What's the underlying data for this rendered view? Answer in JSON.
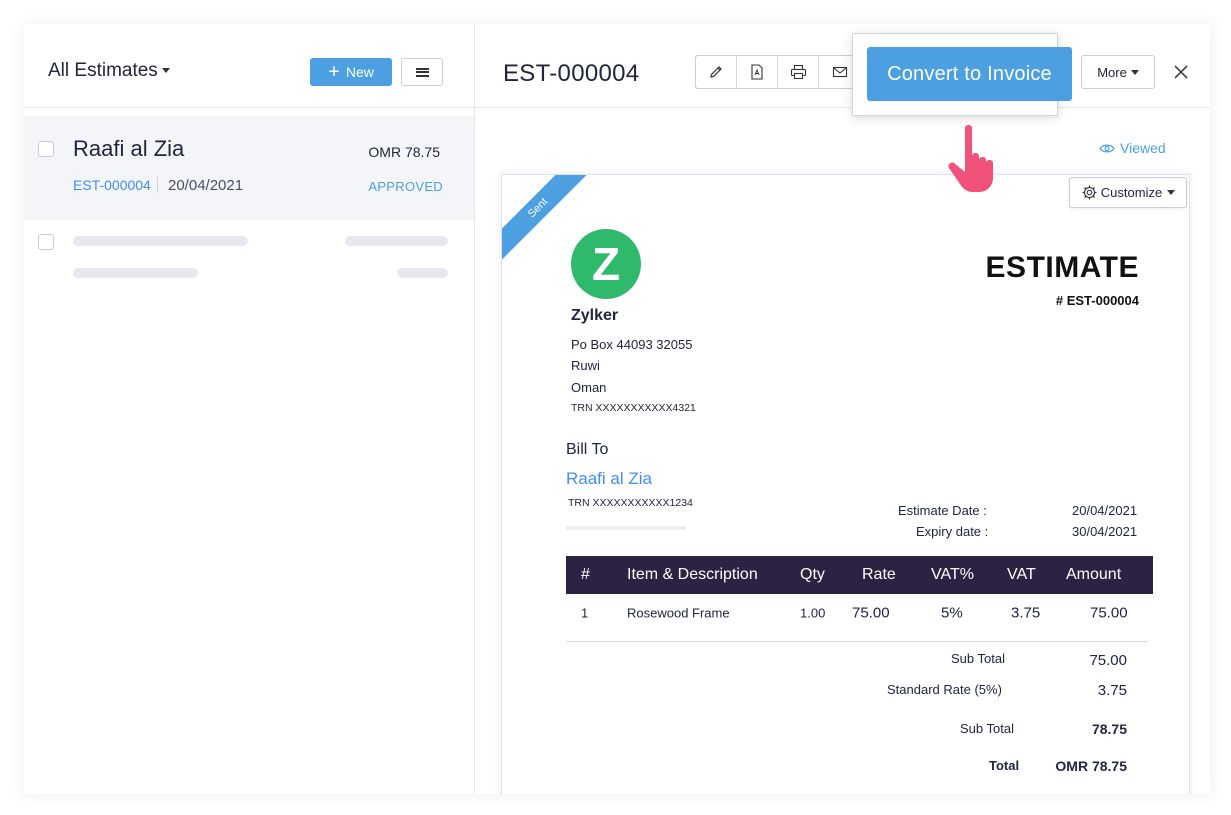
{
  "list": {
    "view_title": "All Estimates",
    "new_button": "New",
    "items": [
      {
        "customer": "Raafi al Zia",
        "amount": "OMR 78.75",
        "number": "EST-000004",
        "date": "20/04/2021",
        "status": "APPROVED"
      }
    ]
  },
  "detail": {
    "title": "EST-000004",
    "toolbar": [
      "pencil-icon",
      "pdf-icon",
      "printer-icon",
      "mail-icon"
    ],
    "convert_label": "Convert to Invoice",
    "more_label": "More",
    "viewed_label": "Viewed",
    "customize_label": "Customize",
    "ribbon": "Sent"
  },
  "document": {
    "logo_letter": "Z",
    "org_name": "Zylker",
    "address": [
      "Po Box 44093 32055",
      "Ruwi",
      "Oman"
    ],
    "org_trn": "TRN XXXXXXXXXXX4321",
    "title": "ESTIMATE",
    "number": "# EST-000004",
    "bill_to_label": "Bill To",
    "bill_to_name": "Raafi al Zia",
    "bill_to_trn": "TRN XXXXXXXXXXX1234",
    "estimate_date_label": "Estimate Date :",
    "estimate_date": "20/04/2021",
    "expiry_date_label": "Expiry date :",
    "expiry_date": "30/04/2021",
    "table_headers": [
      "#",
      "Item & Description",
      "Qty",
      "Rate",
      "VAT%",
      "VAT",
      "Amount"
    ],
    "items": [
      {
        "no": "1",
        "description": "Rosewood Frame",
        "qty": "1.00",
        "rate": "75.00",
        "vat_pct": "5%",
        "vat": "3.75",
        "amount": "75.00"
      }
    ],
    "subtotal_label": "Sub Total",
    "subtotal": "75.00",
    "tax_label": "Standard Rate (5%)",
    "tax": "3.75",
    "subtotal2_label": "Sub Total",
    "subtotal2": "78.75",
    "total_label": "Total",
    "total": "OMR 78.75"
  },
  "colors": {
    "accent": "#4c9fe0",
    "table_header": "#2c2344",
    "logo": "#2fb96a",
    "pointer": "#f0527c"
  }
}
